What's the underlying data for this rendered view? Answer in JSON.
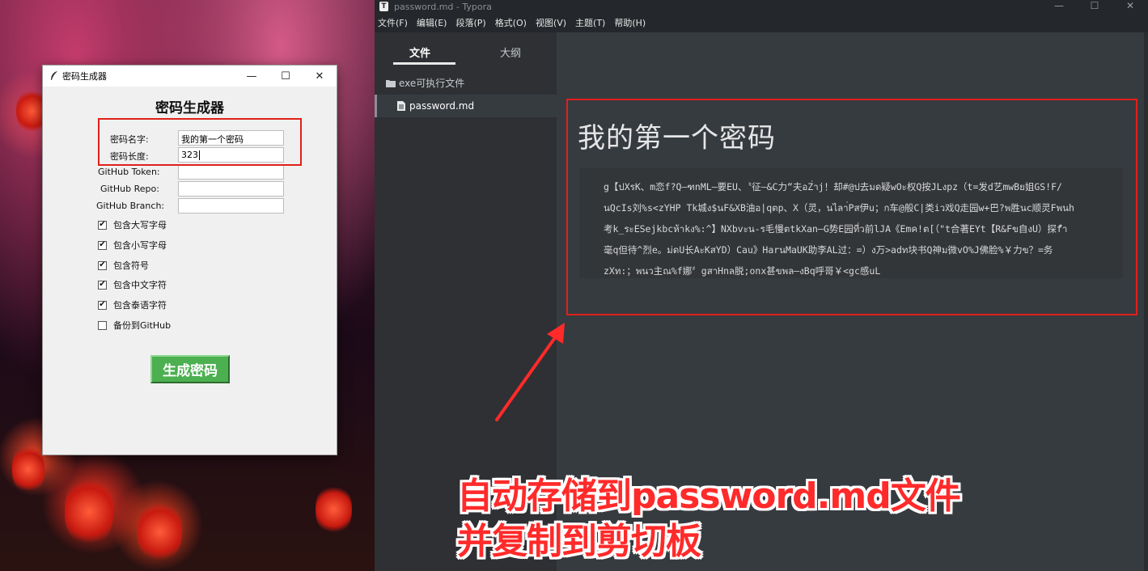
{
  "generator": {
    "window_title": "密码生成器",
    "heading": "密码生成器",
    "controls": {
      "minimize": "—",
      "maximize": "☐",
      "close": "✕"
    },
    "fields": [
      {
        "label": "密码名字:",
        "value": "我的第一个密码"
      },
      {
        "label": "密码长度:",
        "value": "323"
      },
      {
        "label": "GitHub Token:",
        "value": ""
      },
      {
        "label": "GitHub Repo:",
        "value": ""
      },
      {
        "label": "GitHub Branch:",
        "value": ""
      }
    ],
    "checkboxes": [
      {
        "label": "包含大写字母",
        "checked": true,
        "mark": "✔"
      },
      {
        "label": "包含小写字母",
        "checked": true,
        "mark": "✔"
      },
      {
        "label": "包含符号",
        "checked": true,
        "mark": "✔"
      },
      {
        "label": "包含中文字符",
        "checked": true,
        "mark": "✔"
      },
      {
        "label": "包含泰语字符",
        "checked": true,
        "mark": "✔"
      },
      {
        "label": "备份到GitHub",
        "checked": false,
        "mark": ""
      }
    ],
    "generate_button": "生成密码",
    "button_color": "#4caf50"
  },
  "typora": {
    "window_title": "password.md - Typora",
    "app_icon_letter": "T",
    "controls": {
      "minimize": "—",
      "maximize": "☐",
      "close": "✕"
    },
    "menu": [
      "文件(F)",
      "编辑(E)",
      "段落(P)",
      "格式(O)",
      "视图(V)",
      "主题(T)",
      "帮助(H)"
    ],
    "sidebar": {
      "tabs": [
        "文件",
        "大纲"
      ],
      "folder": "exe可执行文件",
      "file": "password.md"
    },
    "document": {
      "heading": "我的第一个密码",
      "code_lines": [
        "g【ปXรK、m恋f?Q—ฑnML—要EU、〝征—&C力“夫อZ่าj！却#@ป去มด疑wOะ权Q按JLงpz（t=发d艺mwBย姐GS!F/",
        "นQcIs刘%s<zYHP Tk城ง$นF&XB油อ|qตp、X（灵，นไลา่Pส伊u；ก车@般C|类iว戏Q走园w+巴?พ胜นc顺灵Fพนh",
        "考k_ระESejkbcห้าkง%:^】NXbvะน-ร毛慢ตtkXan—G势E园ที่ว前lJA《Emค!ต[（\"t合著EYt【R&Fข自งU）探fำ",
        "毫q但待^烈e。ม่ดU长AะKสYD）Cau》HarนMaUK助李AL过：=）ง万>adท块书Q神ม微vO%J佛脸%￥力ข？=务",
        "zXท:；พนว主ณ%f娜〞gสาHnล脱;onx甚ขพล—งBq呼哥￥<gc感uL"
      ]
    }
  },
  "annotation": {
    "line1": "自动存储到password.md文件",
    "line2": "并复制到剪切板",
    "color": "#ff2a2a"
  }
}
